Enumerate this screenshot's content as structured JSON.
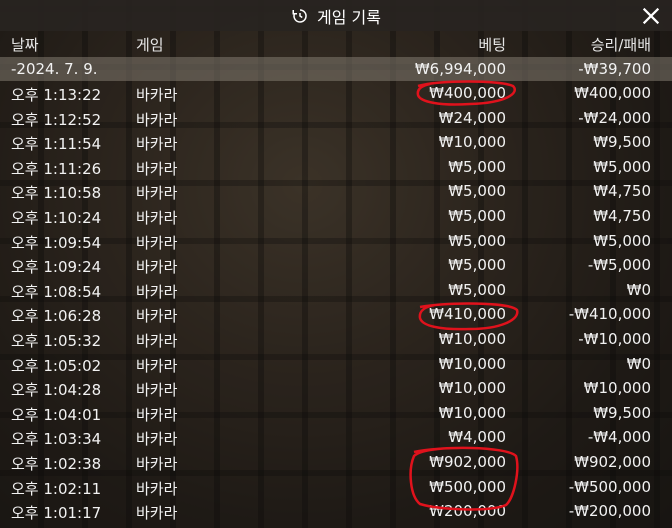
{
  "header": {
    "title": "게임 기록",
    "icon": "history-icon",
    "close": "close-icon"
  },
  "columns": {
    "date": "날짜",
    "game": "게임",
    "bet": "베팅",
    "result": "승리/패배"
  },
  "summary": {
    "date": "-2024. 7. 9.",
    "bet": "₩6,994,000",
    "result": "-₩39,700"
  },
  "rows": [
    {
      "time": "오후 1:13:22",
      "game": "바카라",
      "bet": "₩400,000",
      "result": "₩400,000"
    },
    {
      "time": "오후 1:12:52",
      "game": "바카라",
      "bet": "₩24,000",
      "result": "-₩24,000"
    },
    {
      "time": "오후 1:11:54",
      "game": "바카라",
      "bet": "₩10,000",
      "result": "₩9,500"
    },
    {
      "time": "오후 1:11:26",
      "game": "바카라",
      "bet": "₩5,000",
      "result": "₩5,000"
    },
    {
      "time": "오후 1:10:58",
      "game": "바카라",
      "bet": "₩5,000",
      "result": "₩4,750"
    },
    {
      "time": "오후 1:10:24",
      "game": "바카라",
      "bet": "₩5,000",
      "result": "₩4,750"
    },
    {
      "time": "오후 1:09:54",
      "game": "바카라",
      "bet": "₩5,000",
      "result": "₩5,000"
    },
    {
      "time": "오후 1:09:24",
      "game": "바카라",
      "bet": "₩5,000",
      "result": "-₩5,000"
    },
    {
      "time": "오후 1:08:54",
      "game": "바카라",
      "bet": "₩5,000",
      "result": "₩0"
    },
    {
      "time": "오후 1:06:28",
      "game": "바카라",
      "bet": "₩410,000",
      "result": "-₩410,000"
    },
    {
      "time": "오후 1:05:32",
      "game": "바카라",
      "bet": "₩10,000",
      "result": "-₩10,000"
    },
    {
      "time": "오후 1:05:02",
      "game": "바카라",
      "bet": "₩10,000",
      "result": "₩0"
    },
    {
      "time": "오후 1:04:28",
      "game": "바카라",
      "bet": "₩10,000",
      "result": "₩10,000"
    },
    {
      "time": "오후 1:04:01",
      "game": "바카라",
      "bet": "₩10,000",
      "result": "₩9,500"
    },
    {
      "time": "오후 1:03:34",
      "game": "바카라",
      "bet": "₩4,000",
      "result": "-₩4,000"
    },
    {
      "time": "오후 1:02:38",
      "game": "바카라",
      "bet": "₩902,000",
      "result": "₩902,000"
    },
    {
      "time": "오후 1:02:11",
      "game": "바카라",
      "bet": "₩500,000",
      "result": "-₩500,000"
    },
    {
      "time": "오후 1:01:17",
      "game": "바카라",
      "bet": "₩200,000",
      "result": "-₩200,000"
    }
  ],
  "annotation_color": "#e0121c"
}
